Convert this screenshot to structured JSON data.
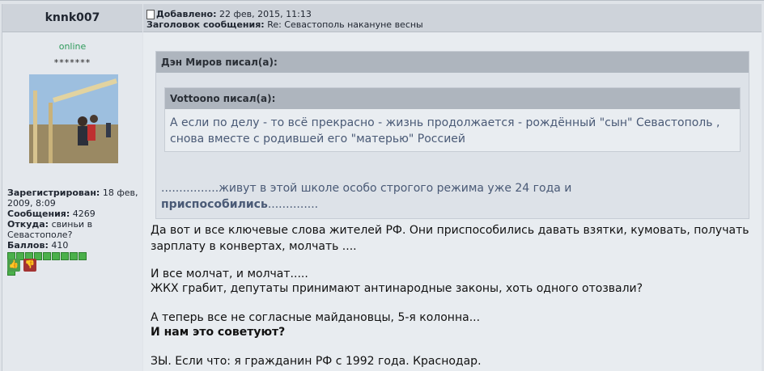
{
  "user": {
    "name": "knnk007",
    "status": "online",
    "stars": "*******",
    "registered_label": "Зарегистрирован:",
    "registered_value_1": "18 фев,",
    "registered_value_2": "2009, 8:09",
    "messages_label": "Сообщения:",
    "messages_value": "4269",
    "from_label": "Откуда:",
    "from_value_1": "свиньи в",
    "from_value_2": "Севастополе?",
    "points_label": "Баллов:",
    "points_value": "410"
  },
  "post": {
    "added_label": "Добавлено:",
    "added_value": "22 фев, 2015, 11:13",
    "subject_label": "Заголовок сообщения:",
    "subject_value": "Re: Севастополь накануне весны"
  },
  "quote_outer": {
    "author": "Дэн Миров писал(а):",
    "line1": "................живут в этой школе особо строгого режима уже 24 года и",
    "line2_bold": "приспособились",
    "line2_rest": ".............."
  },
  "quote_inner": {
    "author": "Vottoono писал(а):",
    "line1": "А если по делу - то всё прекрасно - жизнь продолжается - рождённый \"сын\" Севастополь ,",
    "line2": "снова вместе с родившей его \"матерью\" Россией"
  },
  "body": {
    "p1_l1": "Да вот и все ключевые слова жителей РФ. Они приспособились давать взятки, кумовать, получать",
    "p1_l2": "зарплату в конвертах, молчать ....",
    "p2_l1": "И все молчат, и молчат.....",
    "p2_l2": "ЖКХ грабит, депутаты принимают антинародные законы, хоть одного отозвали?",
    "p3_l1": "А теперь все не согласные майдановцы, 5-я колонна...",
    "p3_l2": "И нам это советуют?",
    "p4_l1": "ЗЫ. Если что: я гражданин РФ с 1992 года. Краснодар."
  },
  "icons": {
    "post_icon": "post-icon",
    "thumb_up": "thumbs-up-icon",
    "thumb_down": "thumbs-down-icon"
  }
}
